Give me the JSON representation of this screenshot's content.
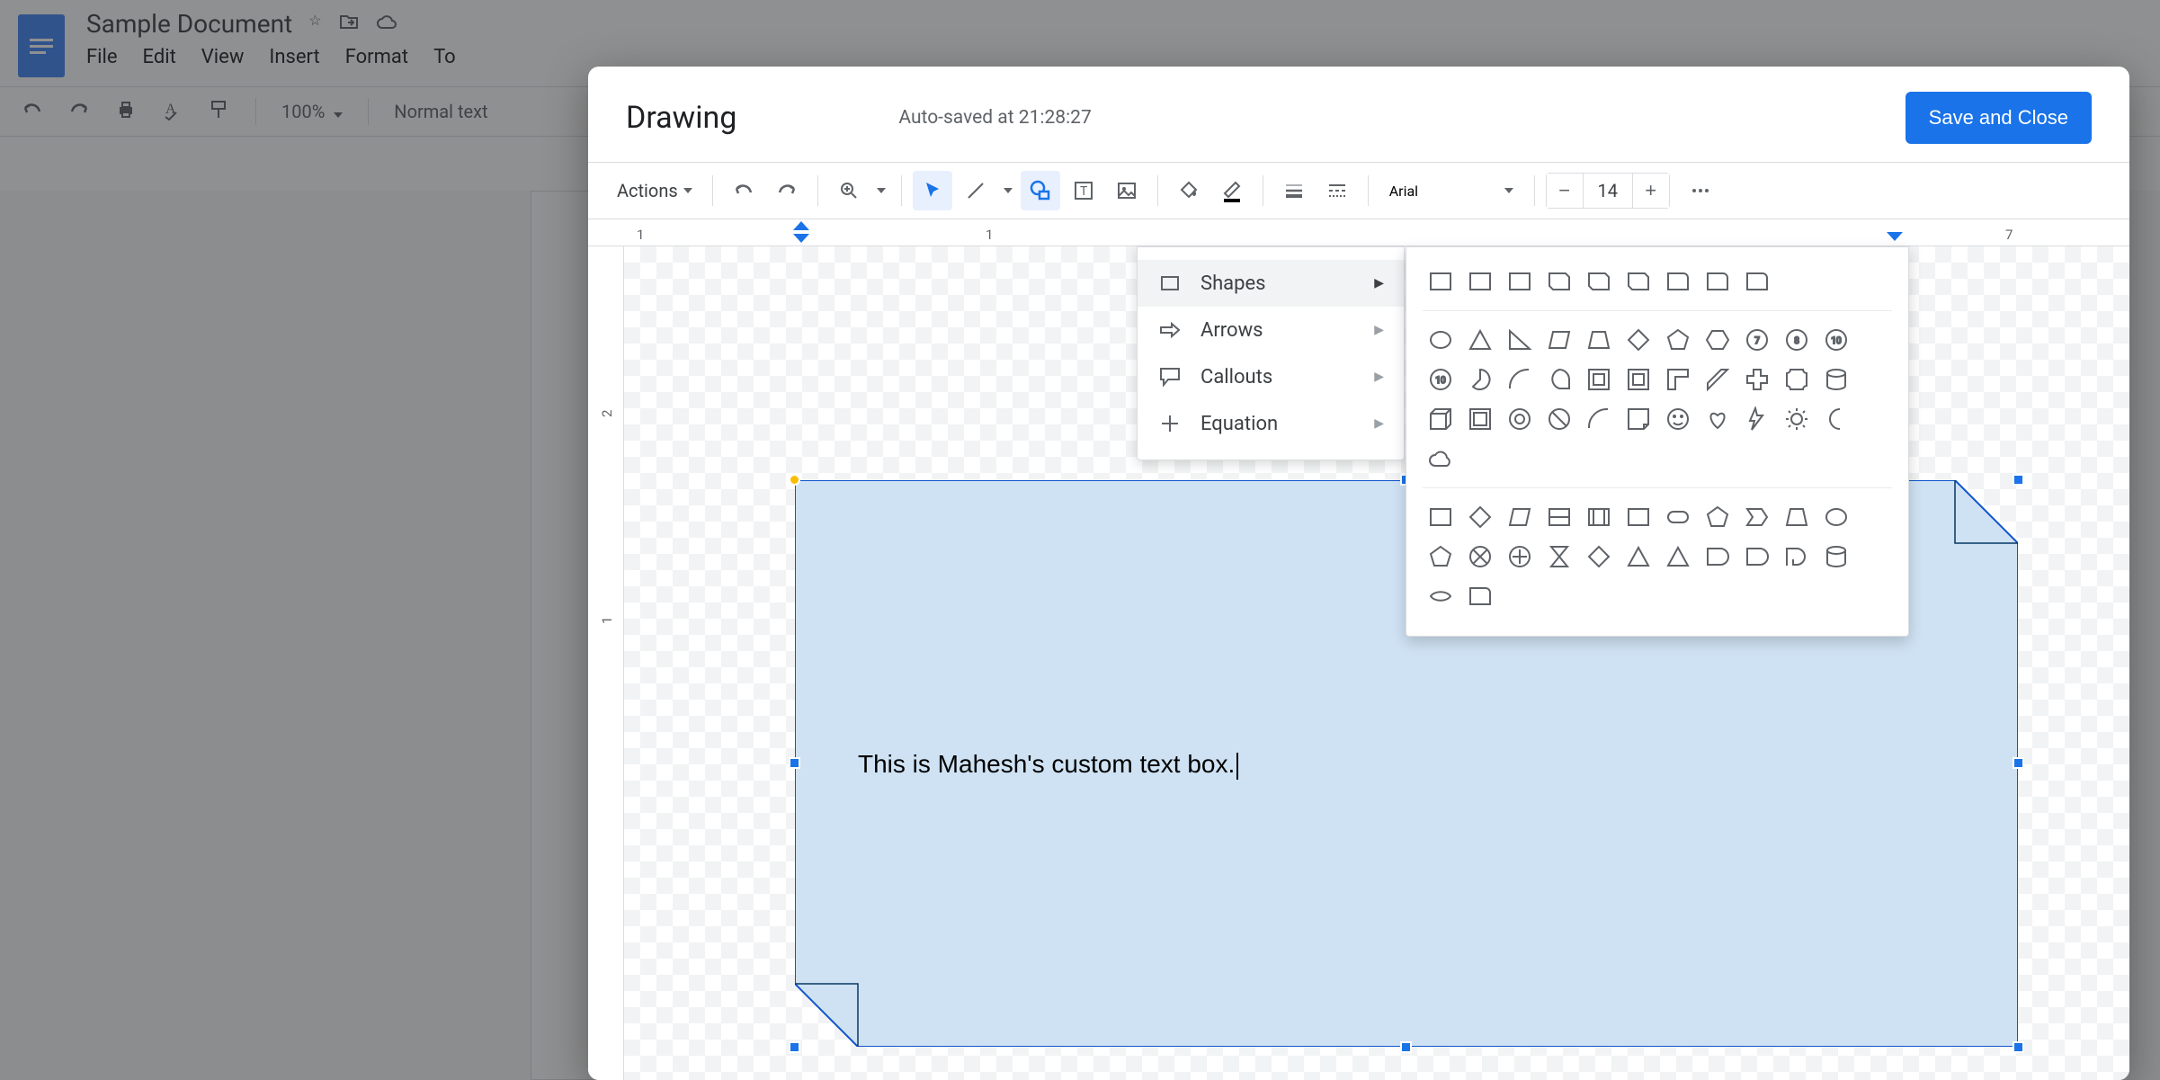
{
  "docs": {
    "title": "Sample Document",
    "menus": [
      "File",
      "Edit",
      "View",
      "Insert",
      "Format",
      "To"
    ],
    "zoom": "100%",
    "style": "Normal text"
  },
  "drawing": {
    "title": "Drawing",
    "status": "Auto-saved at 21:28:27",
    "save_label": "Save and Close",
    "actions_label": "Actions",
    "font_name": "Arial",
    "font_size": "14",
    "ruler_h": [
      "1",
      "1",
      "7"
    ],
    "ruler_v": [
      "2",
      "1"
    ],
    "textbox_content": "This is Mahesh's custom text box.",
    "shape_menu": {
      "items": [
        {
          "label": "Shapes",
          "icon": "rect"
        },
        {
          "label": "Arrows",
          "icon": "arrow"
        },
        {
          "label": "Callouts",
          "icon": "callout"
        },
        {
          "label": "Equation",
          "icon": "plus"
        }
      ]
    },
    "shapes_palette": {
      "group1": [
        "rect",
        "round-rect",
        "snip-rect",
        "snip-2",
        "snip-diag",
        "snip-all",
        "round-1",
        "round-2",
        "round-diag"
      ],
      "group2": [
        "ellipse",
        "triangle",
        "rt-triangle",
        "parallelogram",
        "trapezoid",
        "diamond",
        "pentagon",
        "hexagon",
        "heptagon",
        "octagon",
        "decagon",
        "dodecagon",
        "pie",
        "arc",
        "teardrop",
        "frame",
        "half-frame",
        "l-shape",
        "diag-stripe",
        "plus",
        "plaque",
        "can",
        "cube",
        "bevel",
        "donut",
        "no-symbol",
        "block-arc",
        "folded-corner",
        "smiley",
        "heart",
        "lightning",
        "sun",
        "moon",
        "cloud"
      ],
      "group3": [
        "rect2",
        "diamond2",
        "parallelogram2",
        "rect-slash",
        "rect-bar",
        "multi-rect",
        "stadium",
        "pentagon2",
        "chevron",
        "trap2",
        "ellipse2",
        "pentagon3",
        "crossed-circle",
        "plus-circle",
        "hourglass",
        "small-diamond",
        "triangle2",
        "triangle-down",
        "dshape",
        "dshape2",
        "qshape",
        "cylinder",
        "lens",
        "round-poly"
      ]
    }
  }
}
